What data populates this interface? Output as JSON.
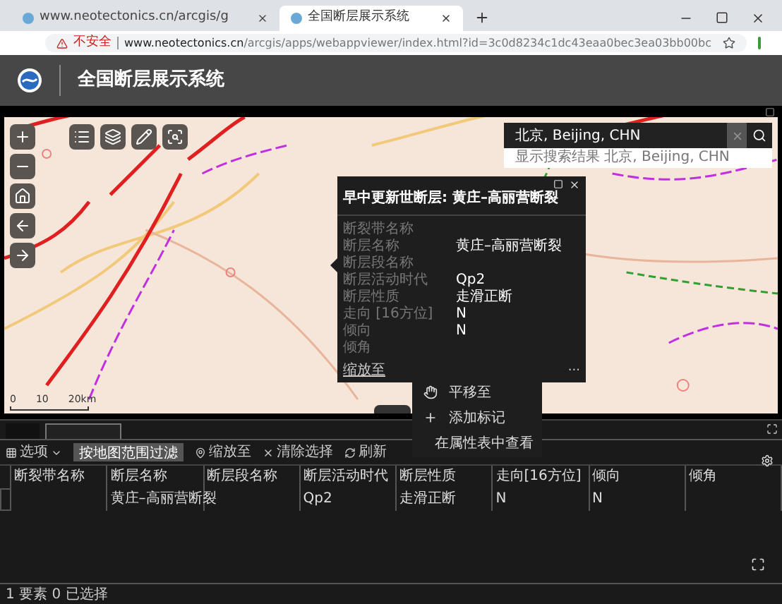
{
  "browser": {
    "tabs": [
      {
        "title": "www.neotectonics.cn/arcgis/g",
        "selected": false
      },
      {
        "title": "全国断层展示系统",
        "selected": true
      }
    ],
    "address": {
      "security": "不安全",
      "domain": "www.neotectonics.cn",
      "path": "/arcgis/apps/webappviewer/index.html?id=3c0d8234c1dc43eaa0bec3ea03bb00bc"
    }
  },
  "app": {
    "title": "全国断层展示系统"
  },
  "map": {
    "search": {
      "value": "北京, Beijing, CHN",
      "result": "显示搜索结果 北京, Beijing, CHN"
    },
    "scale_labels": [
      "0",
      "10",
      "20km"
    ],
    "popup": {
      "title": "早中更新世断层: 黄庄–高丽营断裂",
      "fields": [
        {
          "label": "断裂带名称"
        },
        {
          "label": "断层名称",
          "value": "黄庄–高丽营断裂"
        },
        {
          "label": "断层段名称"
        },
        {
          "label": "断层活动时代",
          "value": "Qp2"
        },
        {
          "label": "断层性质",
          "value": "走滑正断"
        },
        {
          "label": "走向 [16方位]",
          "value": "N"
        },
        {
          "label": "倾向",
          "value": "N"
        },
        {
          "label": "倾角"
        }
      ],
      "zoom_link": "缩放至",
      "more": "···"
    },
    "context_menu": [
      {
        "kind": "pan",
        "label": "平移至"
      },
      {
        "kind": "add",
        "label": "添加标记"
      },
      {
        "kind": "table",
        "label": "在属性表中查看"
      }
    ]
  },
  "attribute_table": {
    "tabs": [
      {
        "selected": false
      },
      {
        "selected": true
      }
    ],
    "toolbar": {
      "options": "选项",
      "filter": {
        "label": "按地图范围过滤",
        "on": true
      },
      "zoom": "缩放至",
      "clear": "清除选择",
      "refresh": "刷新"
    },
    "columns": [
      "断裂带名称",
      "断层名称",
      "断层段名称",
      "断层活动时代",
      "断层性质",
      "走向[16方位]",
      "倾向",
      "倾角"
    ],
    "rows": [
      {
        "selected": false,
        "cells": [
          null,
          "黄庄–高丽营断裂",
          null,
          "Qp2",
          "走滑正断",
          "N",
          "N",
          null
        ]
      }
    ],
    "status": "1 要素 0 已选择"
  }
}
